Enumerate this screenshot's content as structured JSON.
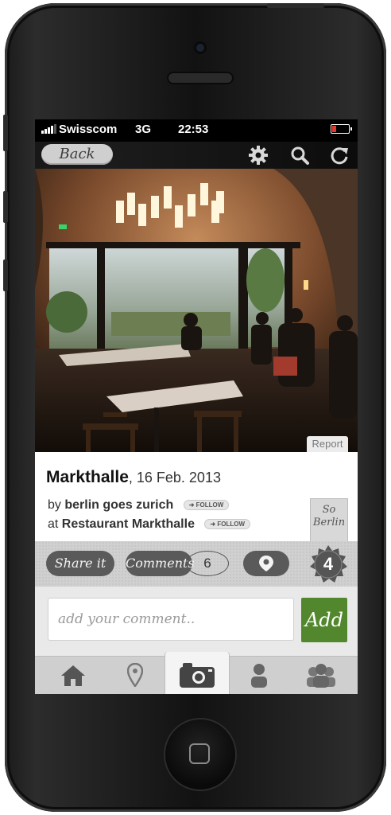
{
  "status_bar": {
    "carrier": "Swisscom",
    "network": "3G",
    "time": "22:53",
    "battery_level": 0.25
  },
  "nav": {
    "back_label": "Back",
    "icons": [
      "gear-icon",
      "search-icon",
      "refresh-icon"
    ]
  },
  "photo": {
    "report_label": "Report"
  },
  "post": {
    "title": "Markthalle",
    "date": ", 16 Feb. 2013",
    "by_prefix": "by",
    "author": "berlin goes zurich",
    "at_prefix": "at",
    "location": "Restaurant Markthalle",
    "follow_label": "FOLLOW",
    "tag_line1": "So",
    "tag_line2": "Berlin"
  },
  "actions": {
    "share_label": "Share it",
    "comments_label": "Comments",
    "comments_count": "6",
    "likes_count": "4"
  },
  "comment": {
    "placeholder": "add your comment..",
    "add_label": "Add"
  },
  "tabs": [
    "home-icon",
    "location-pin-icon",
    "camera-icon",
    "person-icon",
    "people-icon"
  ],
  "colors": {
    "accent_green": "#52872e",
    "pill_dark": "#5a5a5a",
    "battery_red": "#e23b2e"
  }
}
